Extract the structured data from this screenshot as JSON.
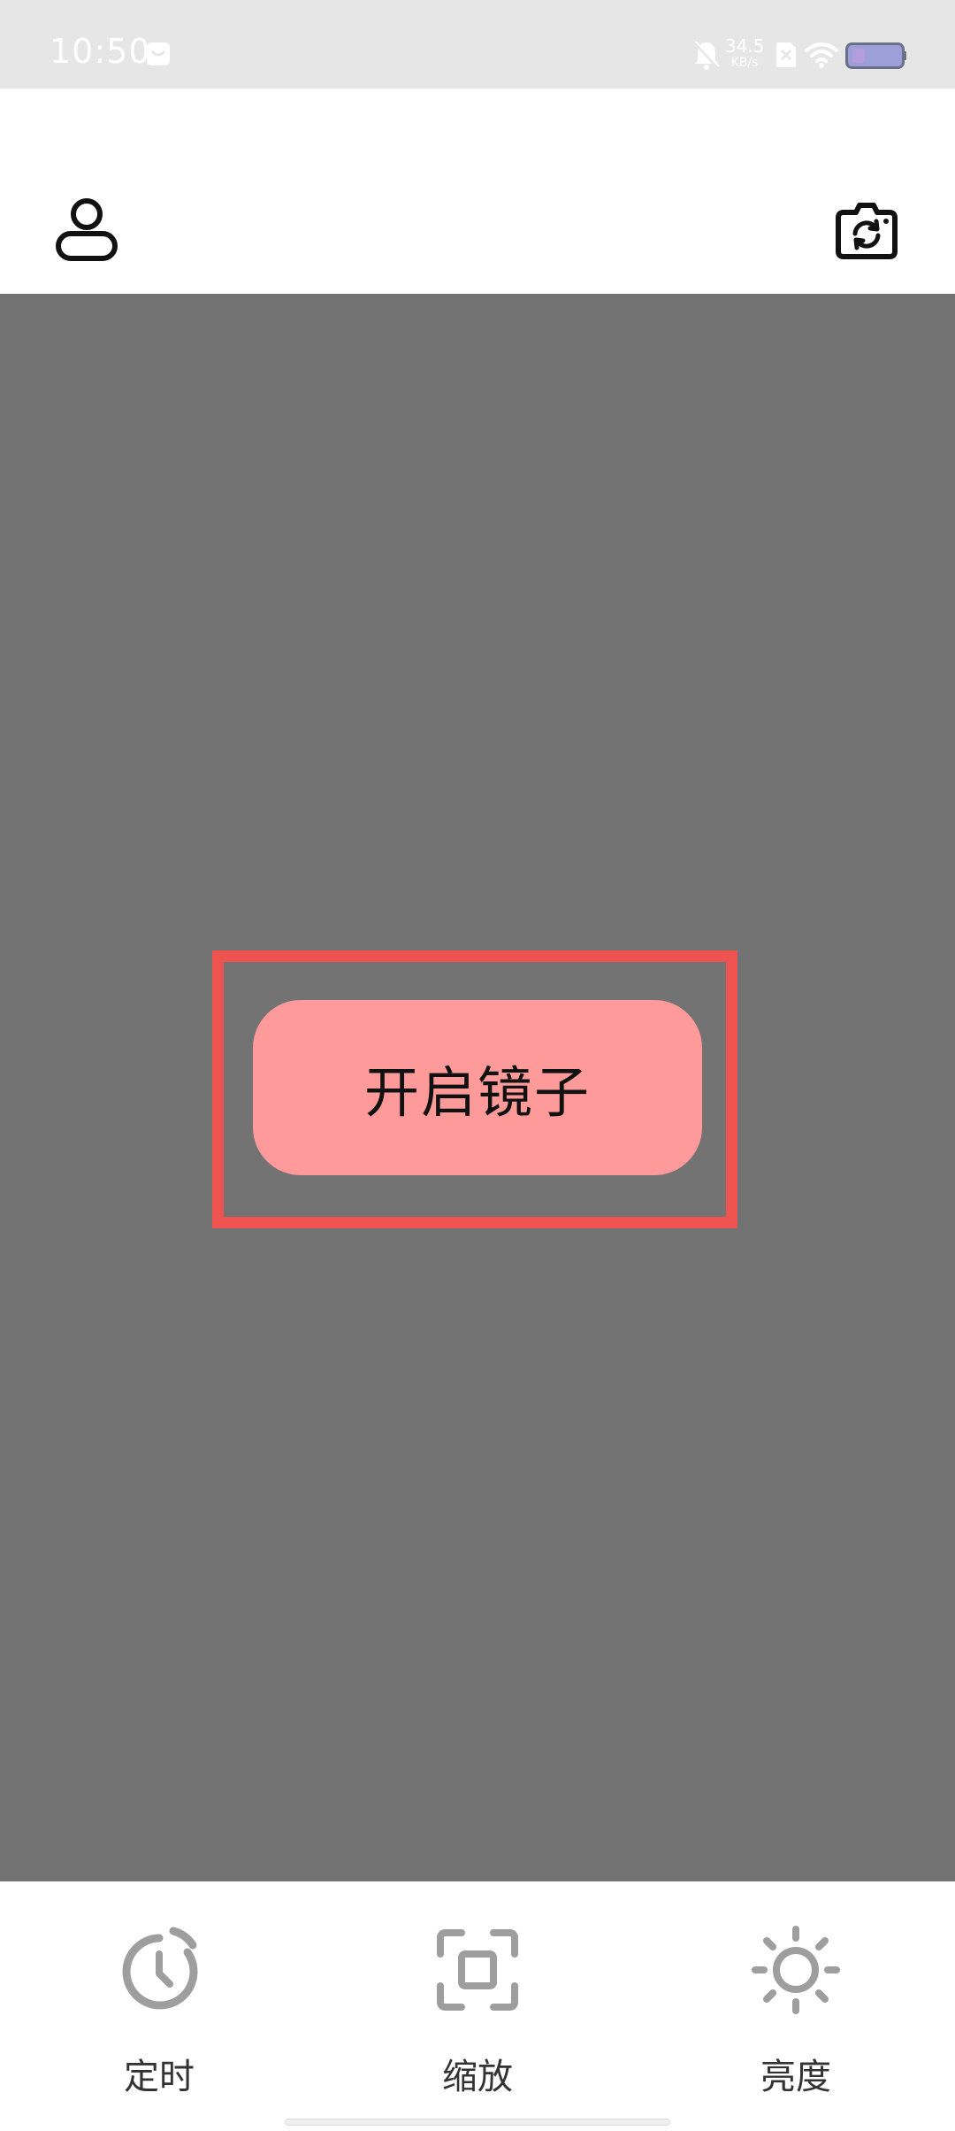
{
  "status_bar": {
    "time": "10:50",
    "network_speed_value": "34.5",
    "network_speed_unit": "KB/s",
    "icons": [
      "notification-box-icon",
      "mute-bell-icon",
      "sim-x-icon",
      "wifi-icon",
      "battery-icon"
    ]
  },
  "header": {
    "left_icon": "user-icon",
    "right_icon": "camera-switch-icon"
  },
  "main": {
    "open_mirror_label": "开启镜子"
  },
  "toolbar": {
    "items": [
      {
        "label": "定时",
        "icon": "timer-icon"
      },
      {
        "label": "缩放",
        "icon": "zoom-frame-icon"
      },
      {
        "label": "亮度",
        "icon": "brightness-icon"
      }
    ]
  },
  "colors": {
    "status_bar_bg": "#e6e6e6",
    "preview_bg": "#737373",
    "highlight_border": "#ef5350",
    "button_bg": "#ff9a9a",
    "toolbar_icon": "#9e9e9e"
  }
}
